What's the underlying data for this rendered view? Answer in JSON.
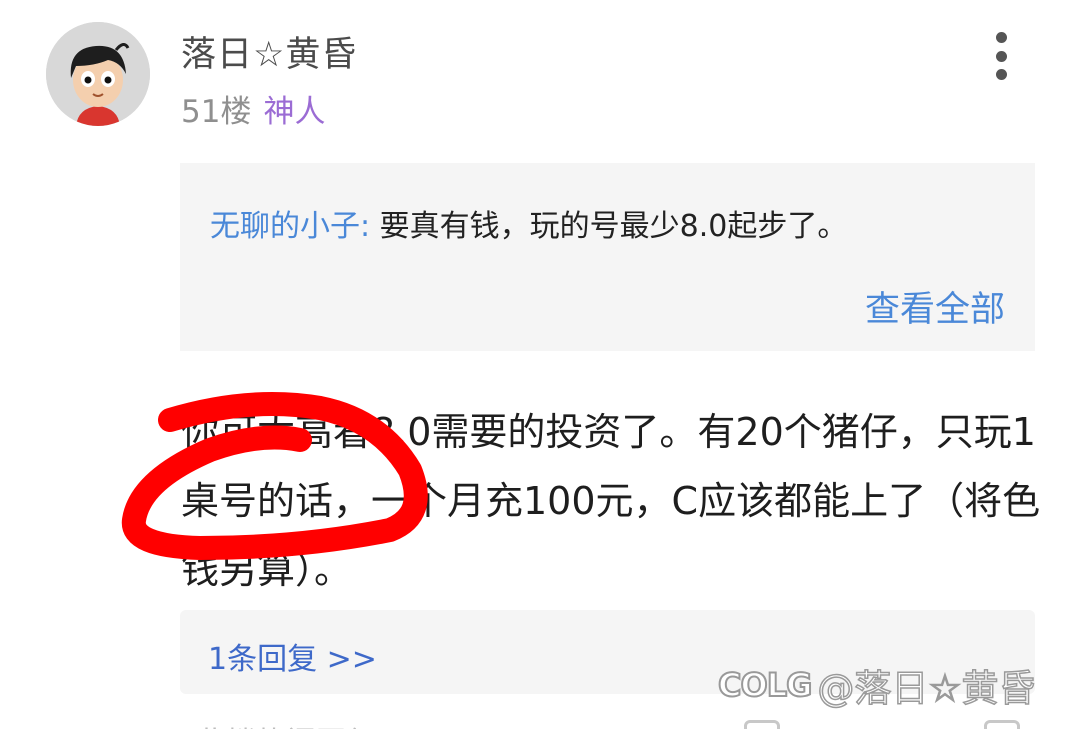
{
  "post": {
    "username": "落日☆黄昏",
    "floor": "51楼",
    "badge": "神人",
    "quote": {
      "author": "无聊的小子:",
      "text": "要真有钱，玩的号最少8.0起步了。",
      "view_all_label": "查看全部"
    },
    "body": "你可太高看8.0需要的投资了。有20个猪仔，只玩1桌号的话，一个月充100元，C应该都能上了（将色钱另算）。",
    "reply_link_label": "1条回复 >>"
  },
  "watermark": {
    "logo": "COLG",
    "text": "@落日☆黄昏"
  },
  "bottom_row": {
    "partial_text": "此楼热门回复"
  },
  "colors": {
    "link_blue": "#4a88d8",
    "badge_purple": "#9b6cd4",
    "annotation_red": "#ff0000",
    "quote_bg": "#f5f5f5"
  },
  "icons": [
    "avatar-cartoon",
    "more-vertical-icon"
  ]
}
